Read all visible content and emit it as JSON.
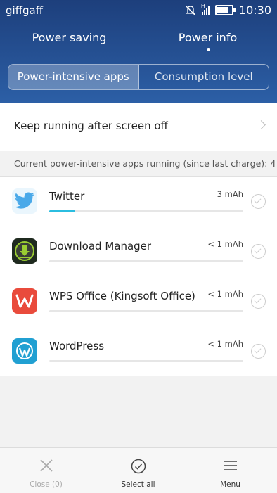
{
  "status_bar": {
    "carrier": "giffgaff",
    "network": "H",
    "time": "10:30"
  },
  "tabs": [
    {
      "label": "Power saving",
      "active": false
    },
    {
      "label": "Power info",
      "active": true
    }
  ],
  "segment": {
    "options": [
      "Power-intensive apps",
      "Consumption level"
    ],
    "selected": "Power-intensive apps"
  },
  "keep_running": {
    "label": "Keep running after screen off"
  },
  "section": {
    "header": "Current power-intensive apps running (since last charge): 4"
  },
  "apps": [
    {
      "name": "Twitter",
      "usage": "3 mAh",
      "usage_fraction": 0.13,
      "icon": "twitter-icon",
      "icon_color": "#4aa9e9"
    },
    {
      "name": "Download Manager",
      "usage": "< 1 mAh",
      "usage_fraction": 0.0,
      "icon": "download-icon",
      "icon_color": "#2f3a2f"
    },
    {
      "name": "WPS Office (Kingsoft Office)",
      "usage": "< 1 mAh",
      "usage_fraction": 0.0,
      "icon": "wps-office-icon",
      "icon_color": "#e94b3c"
    },
    {
      "name": "WordPress",
      "usage": "< 1 mAh",
      "usage_fraction": 0.0,
      "icon": "wordpress-icon",
      "icon_color": "#21a0d2"
    }
  ],
  "bottom_bar": {
    "close": "Close (0)",
    "select_all": "Select all",
    "menu": "Menu"
  },
  "colors": {
    "header": "#2c5fa6",
    "accent_bar": "#2bbde0"
  }
}
